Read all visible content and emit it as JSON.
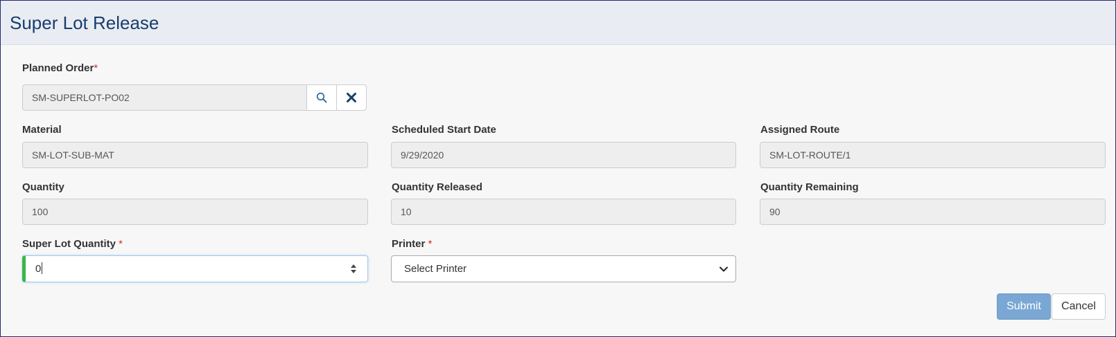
{
  "header": {
    "title": "Super Lot Release"
  },
  "planned_order": {
    "label": "Planned Order",
    "required_mark": "*",
    "value": "SM-SUPERLOT-PO02",
    "search_icon": "search-icon",
    "clear_icon": "close-icon"
  },
  "material": {
    "label": "Material",
    "value": "SM-LOT-SUB-MAT"
  },
  "scheduled_start_date": {
    "label": "Scheduled Start Date",
    "value": "9/29/2020"
  },
  "assigned_route": {
    "label": "Assigned Route",
    "value": "SM-LOT-ROUTE/1"
  },
  "quantity": {
    "label": "Quantity",
    "value": "100"
  },
  "quantity_released": {
    "label": "Quantity Released",
    "value": "10"
  },
  "quantity_remaining": {
    "label": "Quantity Remaining",
    "value": "90"
  },
  "super_lot_quantity": {
    "label": "Super Lot Quantity",
    "required_mark": "*",
    "value": "0"
  },
  "printer": {
    "label": "Printer",
    "required_mark": "*",
    "selected": "Select Printer"
  },
  "actions": {
    "submit_label": "Submit",
    "cancel_label": "Cancel"
  },
  "colors": {
    "header_title": "#173e6e",
    "required": "#d0302b",
    "submit_bg": "#7aa7d4",
    "valid_indicator": "#3cb54a"
  }
}
